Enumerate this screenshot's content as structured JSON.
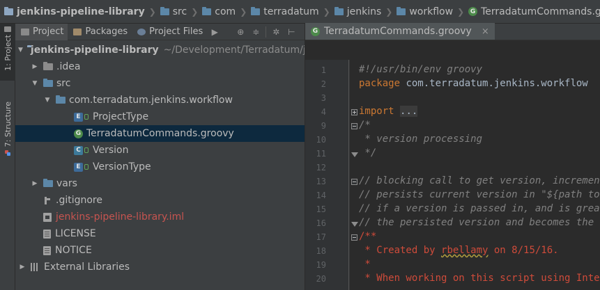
{
  "breadcrumb": {
    "items": [
      "jenkins-pipeline-library",
      "src",
      "com",
      "terradatum",
      "jenkins",
      "workflow",
      "TerradatumCommands.groovy"
    ]
  },
  "toolstrip": {
    "project_tab": "1: Project",
    "structure_tab": "7: Structure"
  },
  "project_panel": {
    "tabs": [
      "Project",
      "Packages",
      "Project Files"
    ]
  },
  "tree": {
    "root": "jenkins-pipeline-library",
    "root_path": "~/Development/Terradatum/jenkins-pipeline-library",
    "idea": ".idea",
    "src": "src",
    "package": "com.terradatum.jenkins.workflow",
    "files": [
      "ProjectType",
      "TerradatumCommands.groovy",
      "Version",
      "VersionType"
    ],
    "vars": "vars",
    "gitignore": ".gitignore",
    "iml": "jenkins-pipeline-library.iml",
    "license": "LICENSE",
    "notice": "NOTICE",
    "external": "External Libraries"
  },
  "editor": {
    "tab_label": "TerradatumCommands.groovy",
    "close_glyph": "×",
    "line_numbers": [
      "1",
      "2",
      "3",
      "4",
      "9",
      "10",
      "11",
      "12",
      "13",
      "14",
      "15",
      "16",
      "17",
      "18",
      "19",
      "20"
    ],
    "lines": {
      "l1": "#!/usr/bin/env groovy",
      "l2_kw": "package",
      "l2_rest": " com.terradatum.jenkins.workflow",
      "l4_kw": "import",
      "l4_fold": "...",
      "l9": "/*",
      "l10": " * version processing",
      "l11": " */",
      "l13": "// blocking call to get version, increment",
      "l14": "// persists current version in \"${path to",
      "l15": "// if a version is passed in, and is grea",
      "l16": "// the persisted version and becomes the",
      "l17": "/**",
      "l18_a": " * Created by ",
      "l18_user": "rbellamy",
      "l18_b": " on 8/15/16.",
      "l19": " *",
      "l20": " * When working on this script using Inte"
    }
  },
  "colors": {
    "panel_bg": "#3c3f41",
    "editor_bg": "#2b2b2b",
    "selection": "#0d293e",
    "keyword": "#cc7832",
    "comment": "#808080",
    "doc_comment": "#cf4b3a",
    "vcs_unversioned": "#c75450"
  }
}
